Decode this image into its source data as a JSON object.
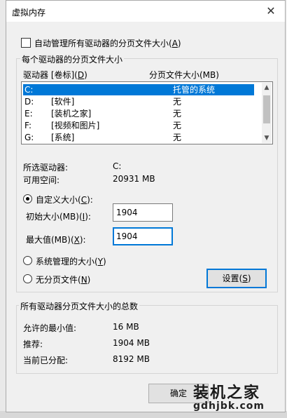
{
  "window": {
    "title": "虚拟内存",
    "close_glyph": "✕"
  },
  "auto_manage": {
    "label": "自动管理所有驱动器的分页文件大小(",
    "hotkey": "A",
    "label_end": ")",
    "checked": false
  },
  "drive_group": {
    "legend": "每个驱动器的分页文件大小",
    "col_drive": "驱动器 [卷标](",
    "col_drive_hotkey": "D",
    "col_drive_end": ")",
    "col_size": "分页文件大小(MB)",
    "drives": [
      {
        "letter": "C:",
        "label": "",
        "size": "托管的系统",
        "selected": true
      },
      {
        "letter": "D:",
        "label": "[软件]",
        "size": "无",
        "selected": false
      },
      {
        "letter": "E:",
        "label": "[装机之家]",
        "size": "无",
        "selected": false
      },
      {
        "letter": "F:",
        "label": "[视频和图片]",
        "size": "无",
        "selected": false
      },
      {
        "letter": "G:",
        "label": "[系统]",
        "size": "无",
        "selected": false
      }
    ],
    "selected_drive_label": "所选驱动器:",
    "selected_drive_value": "C:",
    "free_space_label": "可用空间:",
    "free_space_value": "20931 MB",
    "custom_size": {
      "label": "自定义大小(",
      "hotkey": "C",
      "label_end": "):",
      "selected": true
    },
    "initial_size": {
      "label": "初始大小(MB)(",
      "hotkey": "I",
      "label_end": "):",
      "value": "1904"
    },
    "max_size": {
      "label": "最大值(MB)(",
      "hotkey": "X",
      "label_end": "):",
      "value": "1904"
    },
    "system_managed": {
      "label": "系统管理的大小(",
      "hotkey": "Y",
      "label_end": ")",
      "selected": false
    },
    "no_paging": {
      "label": "无分页文件(",
      "hotkey": "N",
      "label_end": ")",
      "selected": false
    },
    "set_button": {
      "label": "设置(",
      "hotkey": "S",
      "label_end": ")"
    }
  },
  "total_group": {
    "legend": "所有驱动器分页文件大小的总数",
    "min_label": "允许的最小值:",
    "min_value": "16 MB",
    "recommended_label": "推荐:",
    "recommended_value": "1904 MB",
    "current_label": "当前已分配:",
    "current_value": "8192 MB"
  },
  "ok_button": {
    "label": "确定"
  },
  "watermark": {
    "brand": "装机之家",
    "url": "gdhjbk.com"
  }
}
